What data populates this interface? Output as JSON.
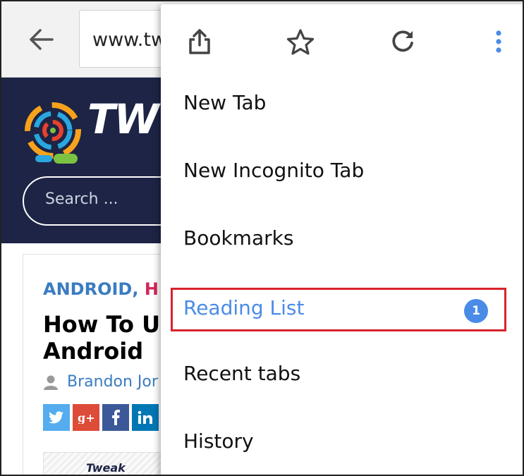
{
  "toolbar": {
    "back_icon": "arrow-left-icon",
    "url": "www.tw"
  },
  "site": {
    "logo_text": "TW",
    "search_placeholder": "Search ..."
  },
  "article": {
    "category_1": "ANDROID",
    "category_separator": ",",
    "category_2": "H",
    "title": "How To U Android",
    "author": "Brandon Jor",
    "social": [
      "twitter-icon",
      "google-plus-icon",
      "facebook-icon",
      "linkedin-icon"
    ],
    "thumbnail_logo": "Tweak"
  },
  "menu": {
    "icons": [
      "share-icon",
      "star-icon",
      "refresh-icon",
      "more-vert-icon"
    ],
    "items": [
      {
        "label": "New Tab"
      },
      {
        "label": "New Incognito Tab"
      },
      {
        "label": "Bookmarks"
      },
      {
        "label": "Reading List",
        "badge": "1",
        "highlighted": true
      },
      {
        "label": "Recent tabs"
      },
      {
        "label": "History"
      }
    ]
  },
  "colors": {
    "site_header": "#1d2445",
    "accent_blue": "#4a8be8",
    "highlight_red": "#d8232c",
    "category_blue": "#3a7cc1",
    "category_red": "#d4275a"
  }
}
